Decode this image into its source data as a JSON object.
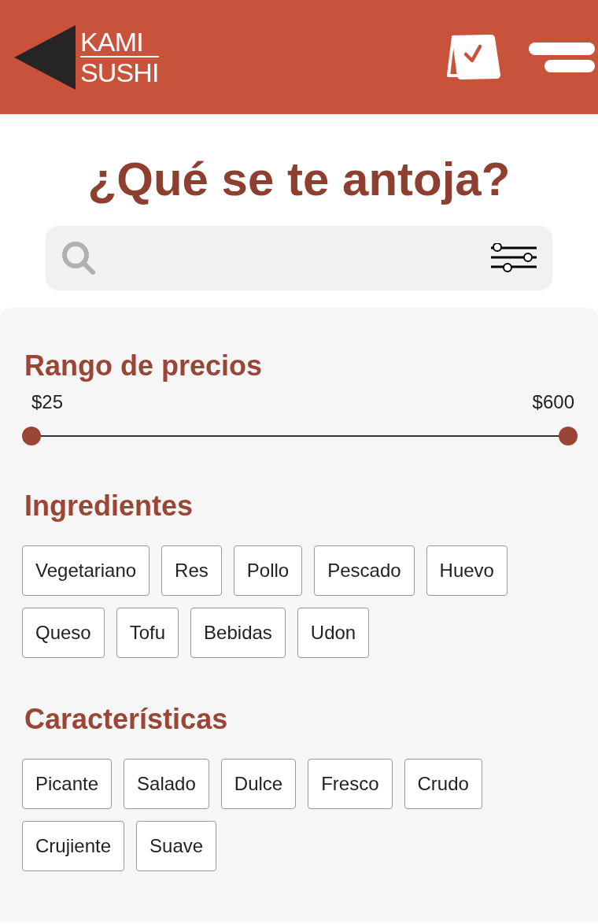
{
  "header": {
    "logo": {
      "line_1": "KAMI",
      "line_2": "SUSHI"
    }
  },
  "title": "¿Qué se te antoja?",
  "price_range": {
    "title": "Rango de precios",
    "min_label": "$25",
    "max_label": "$600",
    "thumbs": [
      {
        "level": 0
      },
      {
        "level": 1
      }
    ]
  },
  "ingredients": {
    "title": "Ingredientes",
    "chips": [
      {
        "label": "Vegetariano",
        "selected": false
      },
      {
        "label": "Res",
        "selected": false
      },
      {
        "label": "Pollo",
        "selected": false
      },
      {
        "label": "Pescado",
        "selected": false
      },
      {
        "label": "Huevo",
        "selected": false
      },
      {
        "label": "Queso",
        "selected": false
      },
      {
        "label": "Tofu",
        "selected": false
      },
      {
        "label": "Bebidas",
        "selected": false
      },
      {
        "label": "Udon",
        "selected": false
      }
    ]
  },
  "characteristics": {
    "title": "Características",
    "chips": [
      {
        "label": "Picante",
        "selected": false
      },
      {
        "label": "Salado",
        "selected": false
      },
      {
        "label": "Dulce",
        "selected": false
      },
      {
        "label": "Fresco",
        "selected": false
      },
      {
        "label": "Crudo",
        "selected": false
      },
      {
        "label": "Crujiente",
        "selected": false
      },
      {
        "label": "Suave",
        "selected": false
      }
    ]
  }
}
